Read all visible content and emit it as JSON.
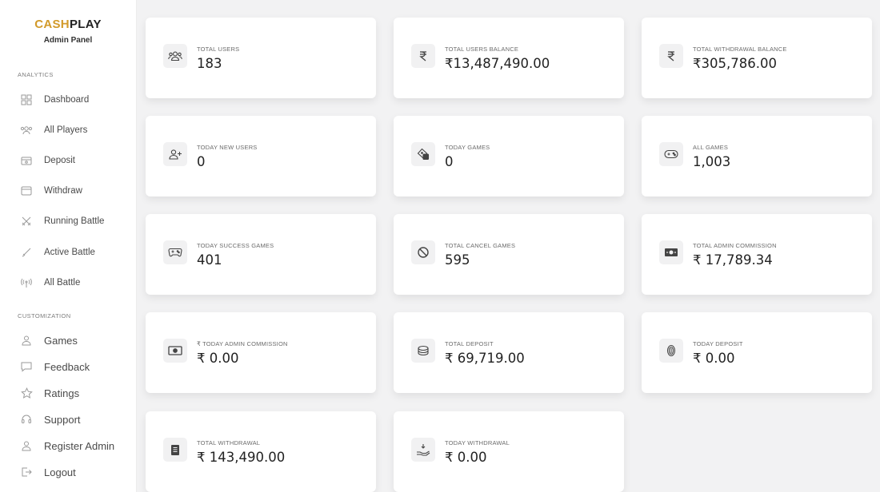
{
  "brand": {
    "logo_part1": "CASH",
    "logo_part2": "PLAY",
    "subtitle": "Admin Panel"
  },
  "sidebar": {
    "analytics_title": "ANALYTICS",
    "customization_title": "CUSTOMIZATION",
    "analytics_items": [
      {
        "label": "Dashboard",
        "icon": "grid-icon"
      },
      {
        "label": "All Players",
        "icon": "users-icon"
      },
      {
        "label": "Deposit",
        "icon": "deposit-icon"
      },
      {
        "label": "Withdraw",
        "icon": "wallet-icon"
      },
      {
        "label": "Running Battle",
        "icon": "swords-icon"
      },
      {
        "label": "Active Battle",
        "icon": "sword-icon"
      },
      {
        "label": "All Battle",
        "icon": "signal-icon"
      }
    ],
    "customization_items": [
      {
        "label": "Games",
        "icon": "user-icon"
      },
      {
        "label": "Feedback",
        "icon": "message-icon"
      },
      {
        "label": "Ratings",
        "icon": "star-icon"
      },
      {
        "label": "Support",
        "icon": "headset-icon"
      },
      {
        "label": "Register Admin",
        "icon": "user-add-icon"
      },
      {
        "label": "Logout",
        "icon": "logout-icon"
      }
    ]
  },
  "cards": [
    {
      "label": "TOTAL USERS",
      "value": "183",
      "icon": "users-icon"
    },
    {
      "label": "TOTAL USERS BALANCE",
      "value": "₹13,487,490.00",
      "icon": "rupee-icon"
    },
    {
      "label": "TOTAL WITHDRAWAL BALANCE",
      "value": "₹305,786.00",
      "icon": "rupee-icon"
    },
    {
      "label": "TODAY NEW USERS",
      "value": "0",
      "icon": "user-add-icon"
    },
    {
      "label": "TODAY GAMES",
      "value": "0",
      "icon": "dice-icon"
    },
    {
      "label": "ALL GAMES",
      "value": "1,003",
      "icon": "gamepad-icon"
    },
    {
      "label": "TODAY SUCCESS GAMES",
      "value": "401",
      "icon": "gamepad-icon"
    },
    {
      "label": "TOTAL CANCEL GAMES",
      "value": "595",
      "icon": "ban-icon"
    },
    {
      "label": "TOTAL ADMIN COMMISSION",
      "value": "₹ 17,789.34",
      "icon": "cash-icon"
    },
    {
      "label": "₹ TODAY ADMIN COMMISSION",
      "value": "₹ 0.00",
      "icon": "cash-icon"
    },
    {
      "label": "TOTAL DEPOSIT",
      "value": "₹ 69,719.00",
      "icon": "coins-icon"
    },
    {
      "label": "TODAY DEPOSIT",
      "value": "₹ 0.00",
      "icon": "coin-icon"
    },
    {
      "label": "TOTAL WITHDRAWAL",
      "value": "₹ 143,490.00",
      "icon": "document-icon"
    },
    {
      "label": "TODAY WITHDRAWAL",
      "value": "₹ 0.00",
      "icon": "hand-coin-icon"
    }
  ]
}
